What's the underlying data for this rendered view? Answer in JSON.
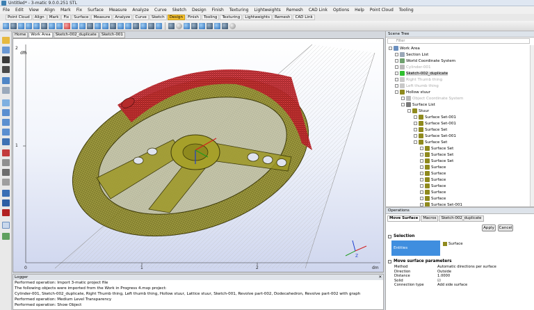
{
  "window": {
    "title": "Untitled* - 3-matic 9.0.0.251 STL"
  },
  "menu": [
    "File",
    "Edit",
    "View",
    "Align",
    "Mark",
    "Fix",
    "Surface",
    "Measure",
    "Analyze",
    "Curve",
    "Sketch",
    "Design",
    "Finish",
    "Texturing",
    "Lightweights",
    "Remesh",
    "CAD Link",
    "Options",
    "Help",
    "Point Cloud",
    "Tooling"
  ],
  "ribbon_tabs": [
    "Point Cloud",
    "Align",
    "Mark",
    "Fix",
    "Surface",
    "Measure",
    "Analyze",
    "Curve",
    "Sketch",
    "Design",
    "Finish",
    "Tooling",
    "Texturing",
    "Lightweights",
    "Remesh",
    "CAD Link"
  ],
  "ribbon_active": "Design",
  "doc_tabs": [
    "Home",
    "Work Area",
    "Sketch-002_duplicate",
    "Sketch-001"
  ],
  "viewport": {
    "unit_top": "dm",
    "unit_right": "dm",
    "y_ticks": [
      "2",
      "1",
      "0"
    ],
    "x_ticks": [
      "0",
      "1",
      "2"
    ],
    "triad_label": "Z"
  },
  "logger": {
    "title": "Logger",
    "lines": [
      "Performed operation: Import 3-matic project file",
      "The following objects were imported from the Work in Progress 4.mxp project:",
      "Cylinder-001, Sketch-002_duplicate, Right Thumb thing, Left thumb thing, Hollow stuur, Lattice stuur, Sketch-001, Revolve part-002, Dodecahedron, Revolve part-002 with graph",
      "Performed operation: Medium Level Transparency",
      "Performed operation: Show Object"
    ]
  },
  "scene_tree": {
    "title": "Scene Tree",
    "filter_placeholder": "Filter",
    "rows": [
      {
        "label": "Work Area",
        "indent": 0,
        "state": "normal"
      },
      {
        "label": "Section List",
        "indent": 1,
        "state": "normal"
      },
      {
        "label": "World Coordinate System",
        "indent": 1,
        "state": "normal"
      },
      {
        "label": "Cylinder-001",
        "indent": 1,
        "state": "dim"
      },
      {
        "label": "Sketch-002_duplicate",
        "indent": 1,
        "state": "selected"
      },
      {
        "label": "Right Thumb thing",
        "indent": 1,
        "state": "dim"
      },
      {
        "label": "Left thumb thing",
        "indent": 1,
        "state": "dim"
      },
      {
        "label": "Hollow stuur",
        "indent": 1,
        "state": "normal"
      },
      {
        "label": "Object Coordinate System",
        "indent": 2,
        "state": "dim"
      },
      {
        "label": "Surface List",
        "indent": 2,
        "state": "normal"
      },
      {
        "label": "Stuur",
        "indent": 3,
        "state": "normal"
      },
      {
        "label": "Surface Set-001",
        "indent": 4,
        "state": "normal"
      },
      {
        "label": "Surface Set-001",
        "indent": 4,
        "state": "normal"
      },
      {
        "label": "Surface Set",
        "indent": 4,
        "state": "normal"
      },
      {
        "label": "Surface Set-001",
        "indent": 4,
        "state": "normal"
      },
      {
        "label": "Surface Set",
        "indent": 4,
        "state": "normal"
      },
      {
        "label": "Surface Set",
        "indent": 5,
        "state": "normal"
      },
      {
        "label": "Surface Set",
        "indent": 5,
        "state": "normal"
      },
      {
        "label": "Surface Set",
        "indent": 5,
        "state": "normal"
      },
      {
        "label": "Surface",
        "indent": 5,
        "state": "normal"
      },
      {
        "label": "Surface",
        "indent": 5,
        "state": "normal"
      },
      {
        "label": "Surface",
        "indent": 5,
        "state": "normal"
      },
      {
        "label": "Surface",
        "indent": 5,
        "state": "normal"
      },
      {
        "label": "Surface",
        "indent": 5,
        "state": "normal"
      },
      {
        "label": "Surface",
        "indent": 5,
        "state": "normal"
      },
      {
        "label": "Surface Set-001",
        "indent": 5,
        "state": "normal"
      }
    ]
  },
  "operations": {
    "title": "Operations",
    "tabs": [
      "Move Surface",
      "Macros",
      "Sketch-002_duplicate"
    ],
    "apply": "Apply",
    "cancel": "Cancel",
    "selection_label": "Selection",
    "entities_label": "Entities",
    "entities_value": "Surface",
    "params_label": "Move surface parameters",
    "params": [
      {
        "key": "Method",
        "value": "Automatic directions per surface"
      },
      {
        "key": "Direction",
        "value": "Outside"
      },
      {
        "key": "Distance",
        "value": "1.0000"
      },
      {
        "key": "Solid",
        "value": "☑"
      },
      {
        "key": "Connection type",
        "value": "Add side surface"
      }
    ]
  },
  "colors": {
    "ribbon_active": "#f6c232",
    "selection_blue": "#3f8edf",
    "mesh_red": "#d8323a",
    "mesh_olive": "#8f8a1e"
  }
}
